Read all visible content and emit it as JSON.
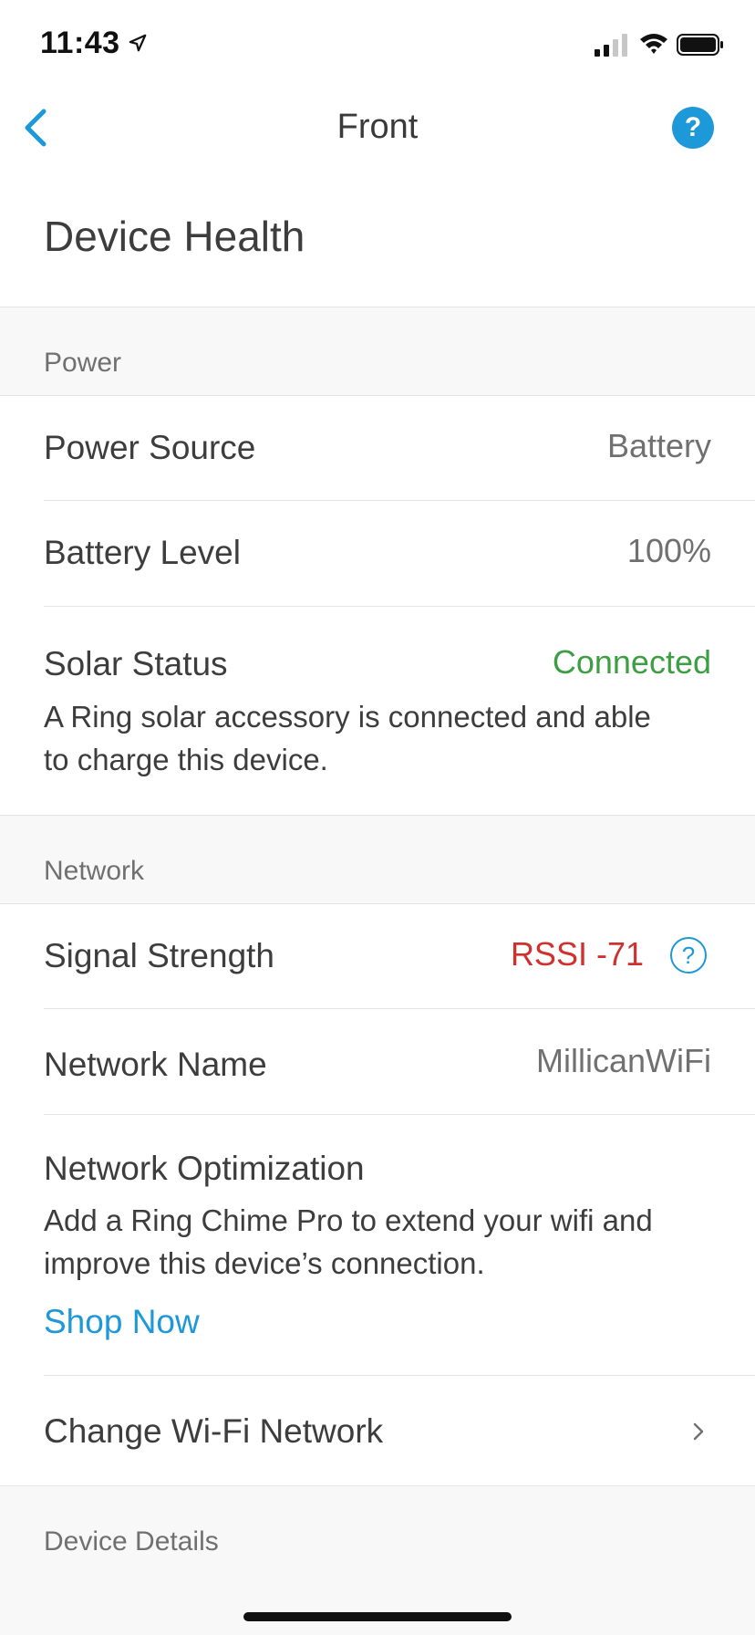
{
  "status_bar": {
    "time": "11:43",
    "icons": [
      "location-arrow-icon",
      "cellular-signal-icon",
      "wifi-icon",
      "battery-icon"
    ]
  },
  "nav": {
    "back_icon": "chevron-left-icon",
    "title": "Front",
    "help_label": "?"
  },
  "page_title": "Device Health",
  "sections": {
    "power": {
      "header": "Power",
      "power_source": {
        "label": "Power Source",
        "value": "Battery"
      },
      "battery_level": {
        "label": "Battery Level",
        "value": "100%"
      },
      "solar_status": {
        "label": "Solar Status",
        "value": "Connected",
        "description": "A Ring solar accessory is connected and able to charge this device."
      }
    },
    "network": {
      "header": "Network",
      "signal_strength": {
        "label": "Signal Strength",
        "value": "RSSI -71",
        "info_label": "?"
      },
      "network_name": {
        "label": "Network Name",
        "value": "MillicanWiFi"
      },
      "network_optimization": {
        "label": "Network Optimization",
        "description": "Add a Ring Chime Pro to extend your wifi and improve this device’s connection.",
        "link": "Shop Now"
      },
      "change_wifi": {
        "label": "Change Wi-Fi Network"
      }
    },
    "device_details": {
      "header": "Device Details"
    }
  },
  "colors": {
    "accent": "#1d98d9",
    "connected": "#3e9e44",
    "warning": "#d1312e",
    "section_bg": "#f8f8f8"
  }
}
